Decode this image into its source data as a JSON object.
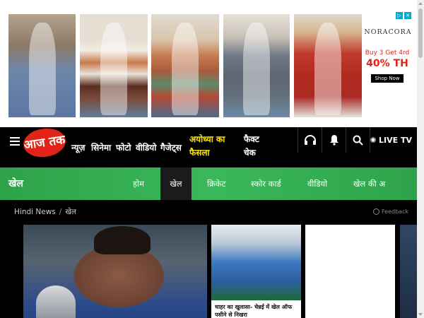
{
  "ad": {
    "brand": "NORACORA",
    "offer": "Buy 3 Get 4rd",
    "percent": "40% TH",
    "cta": "Shop Now",
    "photos": [
      "dress-overalls",
      "striped-sweater",
      "knit-cardigan",
      "grey-top",
      "red-cardigan"
    ]
  },
  "nav": {
    "logo": "आज तक",
    "items": [
      "न्यूज़",
      "सिनेमा",
      "फोटो",
      "वीडियो",
      "गैजेट्स"
    ],
    "highlight_line1": "अयोध्या का",
    "highlight_line2": "फैसला",
    "fact_line1": "फैक्ट",
    "fact_line2": "चेक",
    "live_label": "LIVE TV",
    "highlight_color": "#ffe600"
  },
  "section": {
    "title": "खेल",
    "tabs": [
      "होम",
      "खेल",
      "क्रिकेट",
      "स्कोर कार्ड",
      "वीडियो",
      "खेल की अ"
    ],
    "active_tab": "खेल"
  },
  "breadcrumb": {
    "home": "Hindi News",
    "separator": "/",
    "current": "खेल"
  },
  "feedback_label": "Feedback",
  "cards": {
    "small_caption": "चाहर का खुलासा- चेन्नई में खेल ऑफ पसीने से निखरा"
  },
  "colors": {
    "brand_red": "#e2231a",
    "section_green": "#33ad51"
  }
}
